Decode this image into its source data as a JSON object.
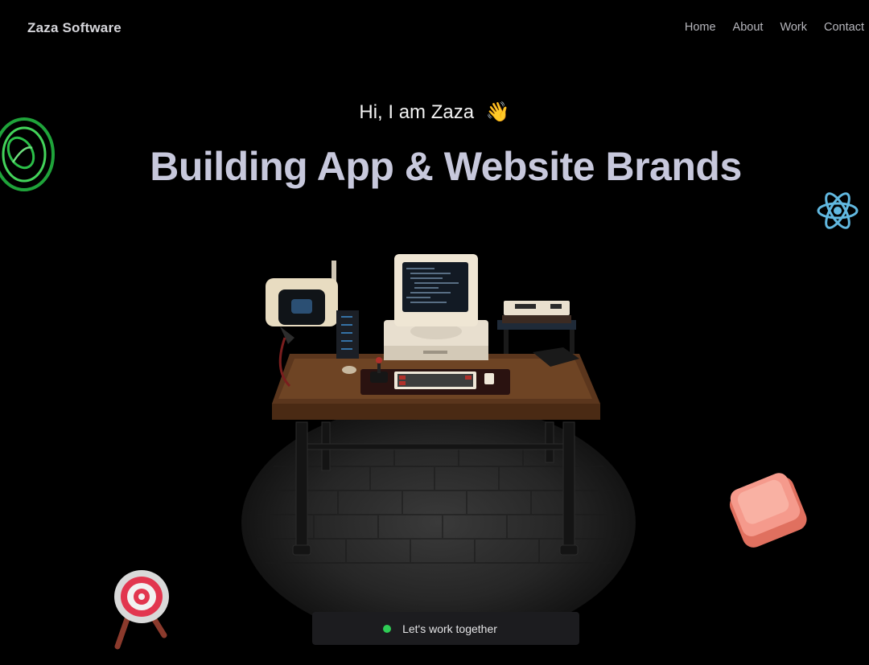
{
  "nav": {
    "brand": "Zaza Software",
    "links": [
      "Home",
      "About",
      "Work",
      "Contact"
    ]
  },
  "hero": {
    "greeting": "Hi, I am Zaza",
    "greeting_emoji": "👋",
    "headline": "Building App & Website Brands"
  },
  "cta": {
    "label": "Let's work together",
    "status_color": "#2ecc55"
  },
  "icons": [
    "spiral-ring-icon",
    "react-atom-icon",
    "target-icon",
    "keycap-icon"
  ],
  "colors": {
    "background": "#000000",
    "headline": "#c7c8dc",
    "accent_green": "#2ecc55",
    "react_blue": "#61b8e0",
    "keycap_pink": "#f38d80"
  }
}
